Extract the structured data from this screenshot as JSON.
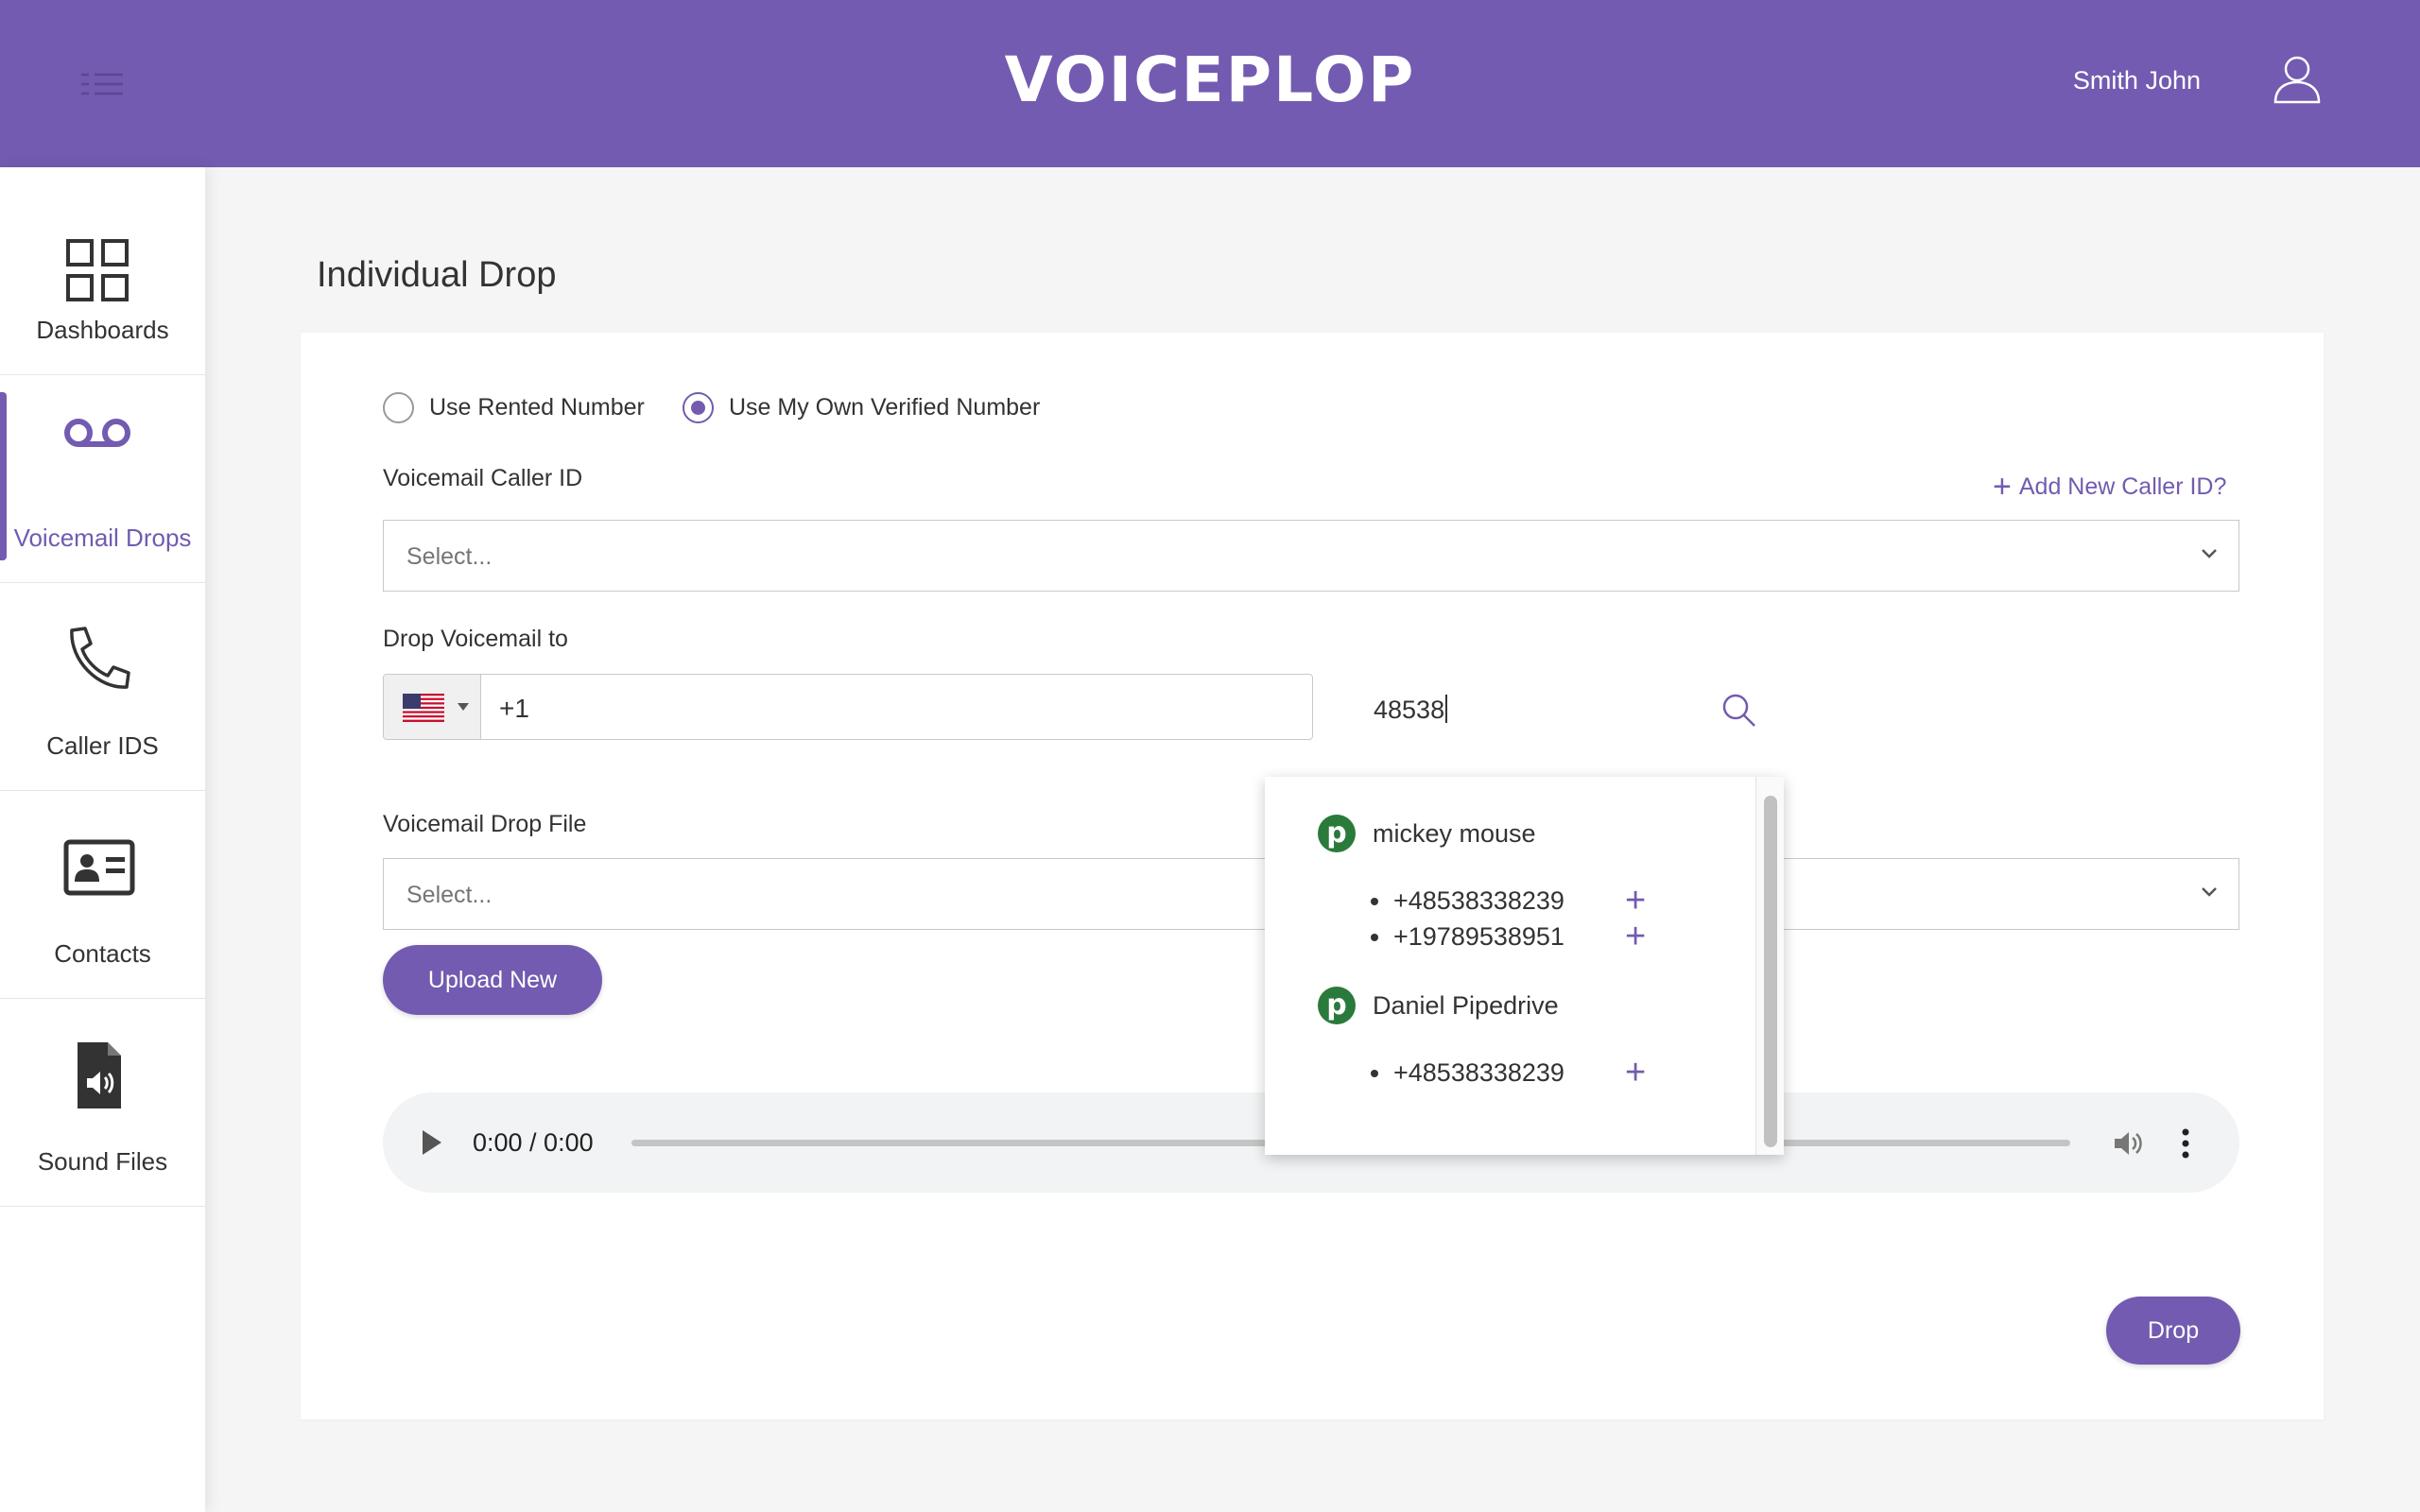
{
  "header": {
    "logo": "VOICEPLOP",
    "user_name": "Smith John"
  },
  "sidebar": {
    "items": [
      {
        "label": "Dashboards",
        "icon": "grid-icon"
      },
      {
        "label": "Voicemail Drops",
        "icon": "voicemail-icon",
        "active": true
      },
      {
        "label": "Caller IDS",
        "icon": "phone-icon"
      },
      {
        "label": "Contacts",
        "icon": "contact-card-icon"
      },
      {
        "label": "Sound Files",
        "icon": "sound-file-icon"
      }
    ]
  },
  "page": {
    "title": "Individual Drop"
  },
  "form": {
    "radio_rented": "Use Rented Number",
    "radio_own": "Use My Own Verified Number",
    "selected_radio": "Use My Own Verified Number",
    "caller_id_label": "Voicemail Caller ID",
    "add_caller_id": "Add New Caller ID?",
    "caller_id_placeholder": "Select...",
    "drop_to_label": "Drop Voicemail to",
    "phone_value": "+1",
    "search_value": "48538",
    "drop_file_label": "Voicemail Drop File",
    "drop_file_placeholder": "Select...",
    "upload_button": "Upload New",
    "audio_time": "0:00 / 0:00",
    "drop_button": "Drop"
  },
  "dropdown": {
    "contacts": [
      {
        "name": "mickey mouse",
        "numbers": [
          "+48538338239",
          "+19789538951"
        ]
      },
      {
        "name": "Daniel Pipedrive",
        "numbers": [
          "+48538338239"
        ]
      }
    ],
    "contact_icon_letter": "p"
  },
  "colors": {
    "brand": "#725bb0",
    "pipedrive_green": "#2a7a3c"
  }
}
